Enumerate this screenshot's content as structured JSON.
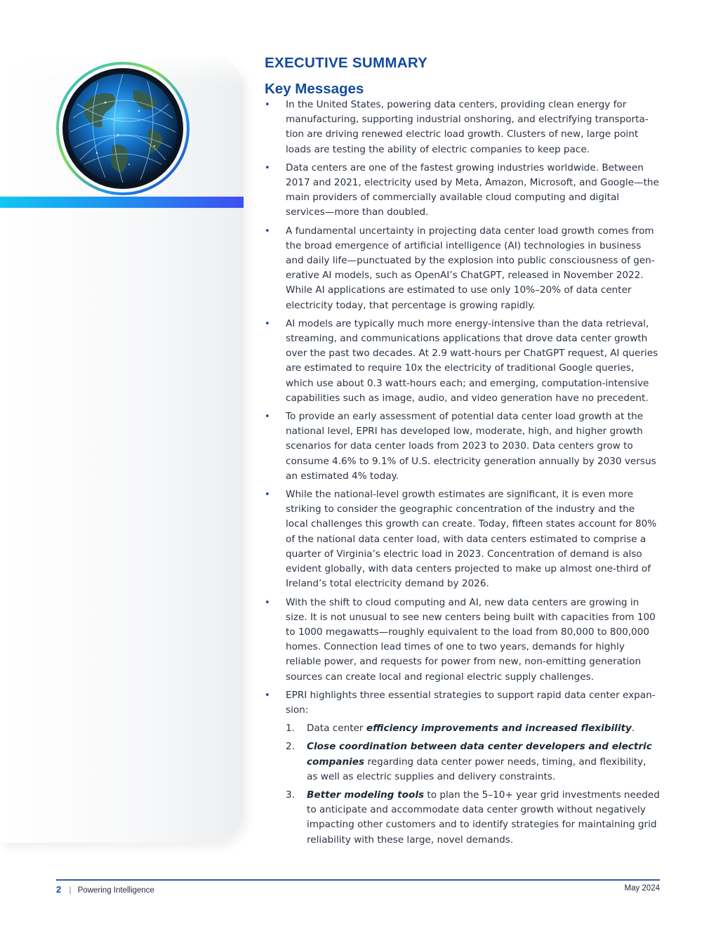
{
  "header": {
    "section_title": "EXECUTIVE SUMMARY",
    "subheading": "Key Messages"
  },
  "globe_image": {
    "icon": "globe-data-network-icon",
    "colors": [
      "#0b1a2b",
      "#1fb6ff",
      "#7ed957",
      "#3f4ff0"
    ]
  },
  "messages": [
    "In the United States, powering data centers, providing clean energy for manufacturing, supporting industrial onshoring, and electrifying transporta­tion are driving renewed electric load growth. Clusters of new, large point loads are testing the ability of electric companies to keep pace.",
    "Data centers are one of the fastest growing industries worldwide. Between 2017 and 2021, electricity used by Meta, Amazon, Microsoft, and Google—the main providers of commercially available cloud computing and digital services—more than doubled.",
    "A fundamental uncertainty in projecting data center load growth comes from the broad emergence of artificial intelligence (AI) technologies in business and daily life—punctuated by the explosion into public consciousness of gen­erative AI models, such as OpenAI’s ChatGPT, released in November 2022. While AI applications are estimated to use only 10%–20% of data center electricity today, that percentage is growing rapidly.",
    "AI models are typically much more energy-intensive than the data retrieval, streaming, and communications applications that drove data center growth over the past two decades. At 2.9 watt-hours per ChatGPT request, AI que­ries are estimated to require 10x the electricity of traditional Google queries, which use about 0.3 watt-hours each; and emerging, computation-intensive capabilities such as image, audio, and video generation have no precedent.",
    "To provide an early assessment of potential data center load growth at the national level, EPRI has developed low, moderate, high, and higher growth scenarios for data center loads from 2023 to 2030. Data centers grow to consume 4.6% to 9.1% of U.S. electricity generation annually by 2030 versus an estimated 4% today.",
    "While the national-level growth estimates are significant, it is even more striking to consider the geographic concentration of the industry and the local challenges this growth can create. Today, fifteen states account for 80% of the national data center load, with data centers estimated to comprise a quarter of Virginia’s electric load in 2023. Concentration of demand is also evident globally, with data centers projected to make up almost one-third of Ireland’s total electricity demand by 2026.",
    "With the shift to cloud computing and AI, new data centers are growing in size. It is not unusual to see new centers being built with capacities from 100 to 1000 megawatts—roughly equivalent to the load from 80,000 to 800,000 homes. Connection lead times of one to two years, demands for highly reliable power, and requests for power from new, non-emitting generation sources can create local and regional electric supply challenges.",
    "EPRI highlights three essential strategies to support rapid data center expan­sion:"
  ],
  "bullet_glyph": "•",
  "strategies": [
    {
      "num": "1.",
      "pre": "Data center ",
      "em": "efficiency improvements and increased flexibility",
      "post": "."
    },
    {
      "num": "2.",
      "pre": "",
      "em": "Close coordination between data center developers and electric com­panies",
      "post": " regarding data center power needs, timing, and flexibility, as well as electric supplies and delivery constraints."
    },
    {
      "num": "3.",
      "pre": "",
      "em": "Better modeling tools",
      "post": " to plan the 5–10+ year grid investments needed to anticipate and accommodate data center growth without negatively impacting other customers and to identify strategies for maintaining grid reliability with these large, novel demands."
    }
  ],
  "footer": {
    "page_number": "2",
    "separator": "|",
    "publication": "Powering Intelligence",
    "date": "May 2024"
  }
}
